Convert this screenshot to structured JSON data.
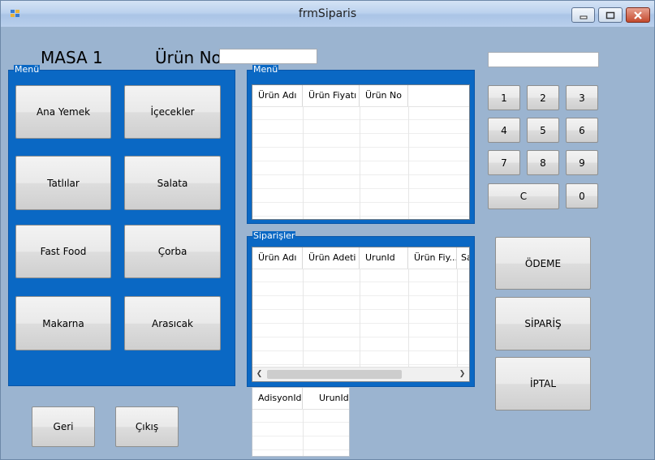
{
  "window": {
    "title": "frmSiparis"
  },
  "labels": {
    "table": "MASA 1",
    "product_no": "Ürün No"
  },
  "inputs": {
    "product_no_value": "",
    "calc_display_value": ""
  },
  "menu_group": {
    "caption": "Menü",
    "buttons": [
      "Ana Yemek",
      "İçecekler",
      "Tatlılar",
      "Salata",
      "Fast Food",
      "Çorba",
      "Makarna",
      "Arasıcak"
    ]
  },
  "menu_grid": {
    "caption": "Menü",
    "columns": [
      "Ürün Adı",
      "Ürün Fiyatı",
      "Ürün No",
      ""
    ]
  },
  "orders_grid": {
    "caption": "Siparişler",
    "columns": [
      "Ürün Adı",
      "Ürün Adeti",
      "UrunId",
      "Ürün Fiy...",
      "Sa"
    ]
  },
  "bill_grid": {
    "columns": [
      "AdisyonId",
      "UrunId"
    ]
  },
  "keypad": {
    "keys": [
      "1",
      "2",
      "3",
      "4",
      "5",
      "6",
      "7",
      "8",
      "9"
    ],
    "clear": "C",
    "zero": "0"
  },
  "actions": {
    "payment": "ÖDEME",
    "order": "SİPARİŞ",
    "cancel": "İPTAL"
  },
  "nav": {
    "back": "Geri",
    "exit": "Çıkış"
  },
  "icons": {
    "minimize": "minimize-icon",
    "maximize": "maximize-icon",
    "close": "close-icon"
  },
  "colors": {
    "groupbox": "#0a68c4",
    "form_bg": "#9bb4d0"
  }
}
